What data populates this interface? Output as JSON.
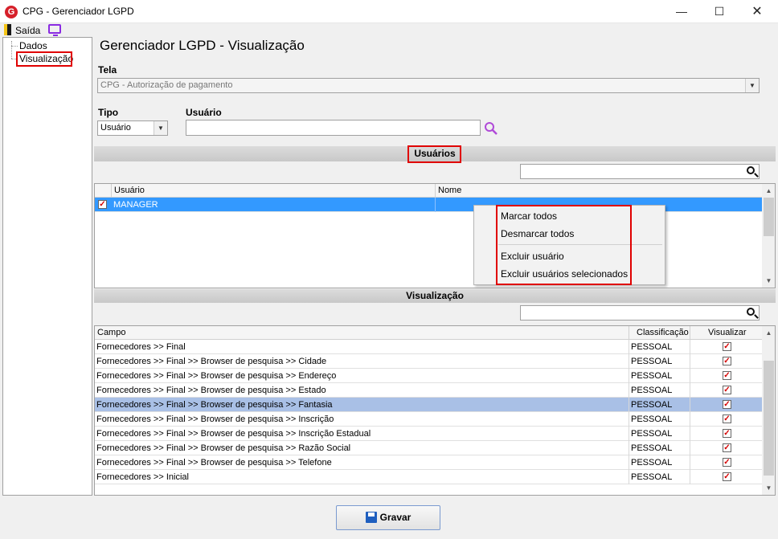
{
  "window": {
    "title": "CPG - Gerenciador LGPD",
    "app_icon_letter": "G"
  },
  "menu": {
    "exit_label": "Saída"
  },
  "tree": {
    "items": [
      "Dados",
      "Visualização"
    ]
  },
  "main": {
    "title": "Gerenciador LGPD - Visualização",
    "screen_label": "Tela",
    "screen_value": "CPG - Autorização de pagamento",
    "type_label": "Tipo",
    "type_value": "Usuário",
    "user_label": "Usuário",
    "user_value": ""
  },
  "users_section": {
    "title": "Usuários",
    "search_value": "",
    "columns": [
      "Usuário",
      "Nome"
    ],
    "rows": [
      {
        "checked": true,
        "user": "MANAGER",
        "name": ""
      }
    ]
  },
  "context_menu": {
    "items": [
      "Marcar todos",
      "Desmarcar todos",
      "Excluir usuário",
      "Excluir usuários selecionados"
    ]
  },
  "view_section": {
    "title": "Visualização",
    "search_value": "",
    "columns": [
      "Campo",
      "Classificação",
      "Visualizar"
    ],
    "rows": [
      {
        "field": "Fornecedores >> Final",
        "class": "PESSOAL",
        "view": true
      },
      {
        "field": "Fornecedores >> Final >> Browser de pesquisa >> Cidade",
        "class": "PESSOAL",
        "view": true
      },
      {
        "field": "Fornecedores >> Final >> Browser de pesquisa >> Endereço",
        "class": "PESSOAL",
        "view": true
      },
      {
        "field": "Fornecedores >> Final >> Browser de pesquisa >> Estado",
        "class": "PESSOAL",
        "view": true
      },
      {
        "field": "Fornecedores >> Final >> Browser de pesquisa >> Fantasia",
        "class": "PESSOAL",
        "view": true
      },
      {
        "field": "Fornecedores >> Final >> Browser de pesquisa >> Inscrição",
        "class": "PESSOAL",
        "view": true
      },
      {
        "field": "Fornecedores >> Final >> Browser de pesquisa >> Inscrição Estadual",
        "class": "PESSOAL",
        "view": true
      },
      {
        "field": "Fornecedores >> Final >> Browser de pesquisa >> Razão Social",
        "class": "PESSOAL",
        "view": true
      },
      {
        "field": "Fornecedores >> Final >> Browser de pesquisa >> Telefone",
        "class": "PESSOAL",
        "view": true
      },
      {
        "field": "Fornecedores >> Inicial",
        "class": "PESSOAL",
        "view": true
      }
    ]
  },
  "footer": {
    "save_label": "Gravar"
  },
  "colors": {
    "selected_row_blue": "#3399ff",
    "highlight_row": "#a9c0e6",
    "annotation_red": "#e00000",
    "search_icon_purple": "#b04ad8"
  }
}
